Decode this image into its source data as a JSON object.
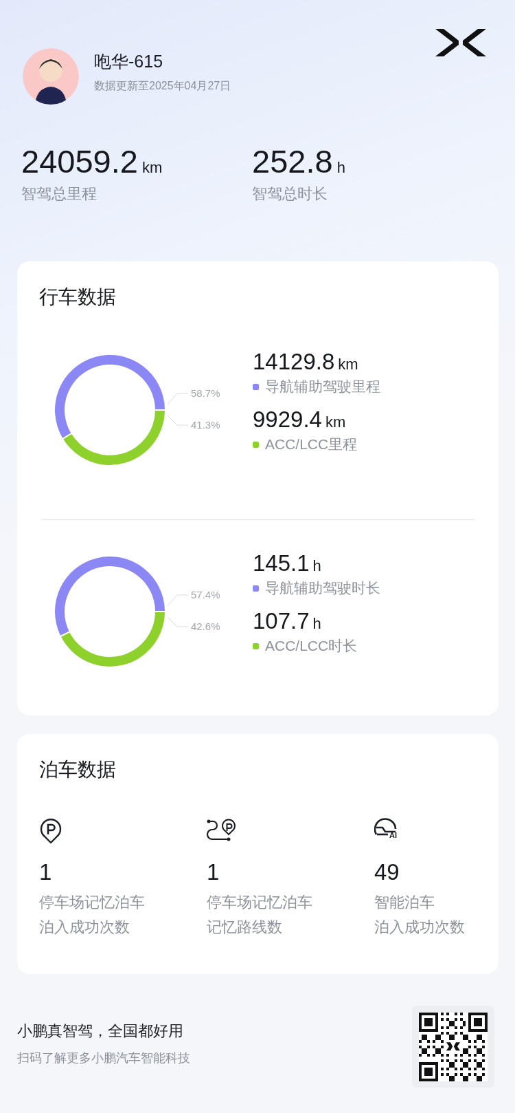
{
  "profile": {
    "name": "咆华-615",
    "updated": "数据更新至2025年04月27日"
  },
  "totals": [
    {
      "value": "24059.2",
      "unit": "km",
      "label": "智驾总里程"
    },
    {
      "value": "252.8",
      "unit": "h",
      "label": "智驾总时长"
    }
  ],
  "driving": {
    "title": "行车数据",
    "groups": [
      {
        "chart_data": {
          "type": "donut",
          "values": [
            58.7,
            41.3
          ],
          "value_labels": [
            "58.7%",
            "41.3%"
          ]
        },
        "legend": [
          {
            "value": "14129.8",
            "unit": "km",
            "label": "导航辅助驾驶里程",
            "color": "#8b87f5"
          },
          {
            "value": "9929.4",
            "unit": "km",
            "label": "ACC/LCC里程",
            "color": "#8fd12c"
          }
        ]
      },
      {
        "chart_data": {
          "type": "donut",
          "values": [
            57.4,
            42.6
          ],
          "value_labels": [
            "57.4%",
            "42.6%"
          ]
        },
        "legend": [
          {
            "value": "145.1",
            "unit": "h",
            "label": "导航辅助驾驶时长",
            "color": "#8b87f5"
          },
          {
            "value": "107.7",
            "unit": "h",
            "label": "ACC/LCC时长",
            "color": "#8fd12c"
          }
        ]
      }
    ]
  },
  "parking": {
    "title": "泊车数据",
    "items": [
      {
        "kind": "pin",
        "value": "1",
        "label_lines": [
          "停车场记忆泊车",
          "泊入成功次数"
        ]
      },
      {
        "kind": "route",
        "value": "1",
        "label_lines": [
          "停车场记忆泊车",
          "记忆路线数"
        ]
      },
      {
        "kind": "smart",
        "badge": "AI",
        "value": "49",
        "label_lines": [
          "智能泊车",
          "泊入成功次数"
        ]
      }
    ]
  },
  "footer": {
    "slogan": "小鹏真智驾，全国都好用",
    "hint": "扫码了解更多小鹏汽车智能科技"
  }
}
